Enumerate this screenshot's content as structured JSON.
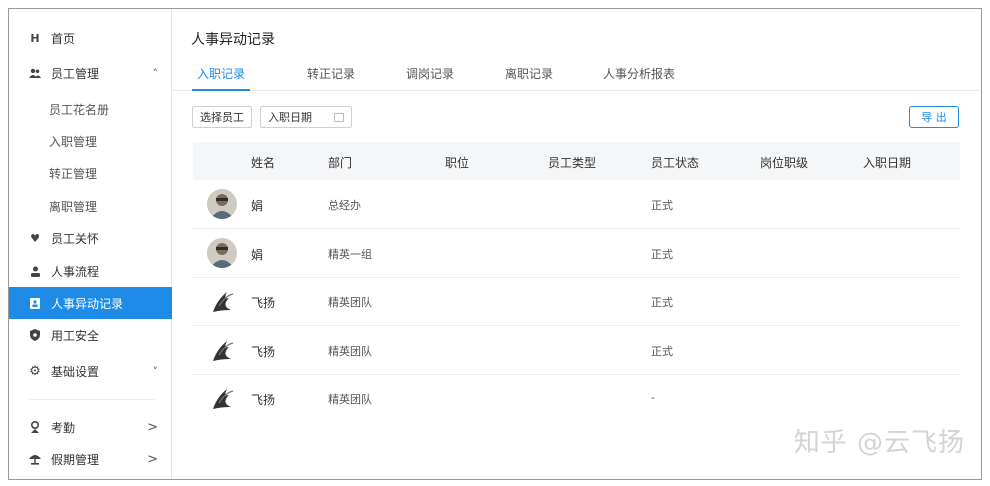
{
  "sidebar": {
    "home": {
      "label": "首页",
      "icon": "home-icon"
    },
    "staff_mgmt": {
      "label": "员工管理",
      "icon": "users-icon"
    },
    "sub_items": [
      "员工花名册",
      "入职管理",
      "转正管理",
      "离职管理"
    ],
    "care": {
      "label": "员工关怀",
      "icon": "heart-icon"
    },
    "flow": {
      "label": "人事流程",
      "icon": "person-icon"
    },
    "records": {
      "label": "人事异动记录",
      "icon": "record-icon"
    },
    "safety": {
      "label": "用工安全",
      "icon": "shield-icon"
    },
    "settings": {
      "label": "基础设置",
      "icon": "gear-icon"
    },
    "attendance": {
      "label": "考勤",
      "icon": "location-pin-icon"
    },
    "leave": {
      "label": "假期管理",
      "icon": "umbrella-icon"
    },
    "expanded_chevron": "˄",
    "collapsed_chevron": "˅",
    "arrow": ">"
  },
  "main": {
    "title": "人事异动记录",
    "tabs": [
      "入职记录",
      "转正记录",
      "调岗记录",
      "离职记录",
      "人事分析报表"
    ],
    "toolbar": {
      "select_employee": "选择员工",
      "entry_date": "入职日期",
      "export": "导 出"
    },
    "columns": [
      "姓名",
      "部门",
      "职位",
      "员工类型",
      "员工状态",
      "岗位职级",
      "入职日期"
    ],
    "rows": [
      {
        "name": "娟",
        "dept": "总经办",
        "status": "正式",
        "avatar": "photo"
      },
      {
        "name": "娟",
        "dept": "精英一组",
        "status": "正式",
        "avatar": "photo"
      },
      {
        "name": "飞扬",
        "dept": "精英团队",
        "status": "正式",
        "avatar": "art"
      },
      {
        "name": "飞扬",
        "dept": "精英团队",
        "status": "正式",
        "avatar": "art"
      },
      {
        "name": "飞扬",
        "dept": "精英团队",
        "status": "-",
        "avatar": "art"
      }
    ]
  },
  "watermark": "知乎 @云飞扬",
  "colors": {
    "accent": "#1e8ce6",
    "header_bg": "#f5f6f7"
  }
}
